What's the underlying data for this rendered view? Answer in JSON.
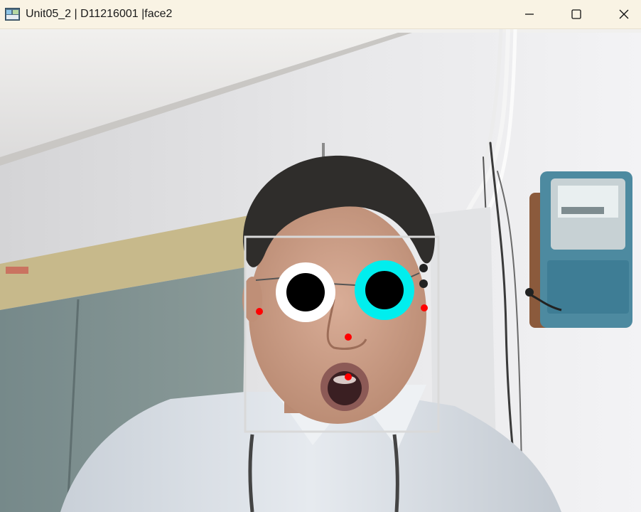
{
  "window": {
    "title": "Unit05_2 | D11216001 |face2",
    "app_icon": "opencv-window-icon",
    "controls": {
      "minimize_icon": "minimize-icon",
      "maximize_icon": "maximize-icon",
      "close_icon": "close-icon"
    }
  },
  "colors": {
    "titlebar_bg": "#f9f3e4",
    "face_box": "#d9d9d9",
    "left_eye_ring": "#ffffff",
    "right_eye_ring": "#00eeee",
    "pupil": "#000000",
    "landmark": "#ff0000"
  }
}
